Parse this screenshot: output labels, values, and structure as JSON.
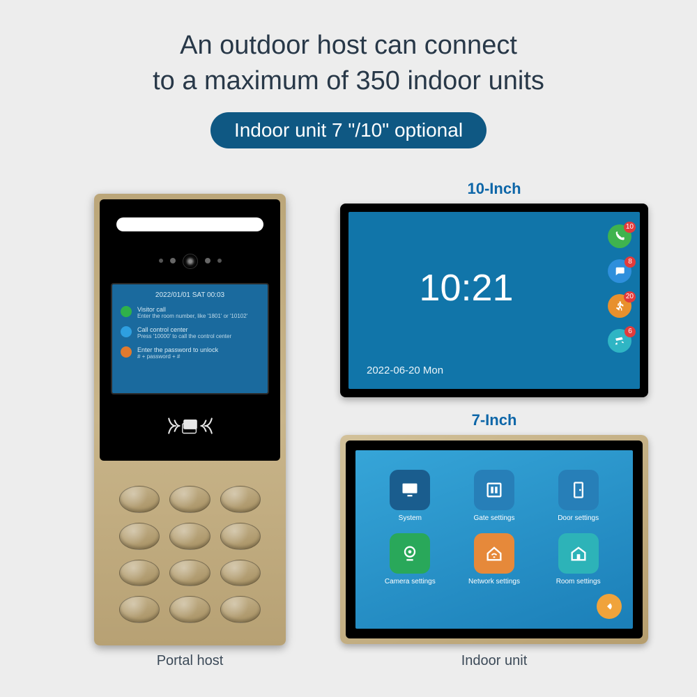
{
  "headline_l1": "An outdoor host can connect",
  "headline_l2": "to a maximum of 350 indoor units",
  "pill": "Indoor unit 7 \"/10\" optional",
  "portal_caption": "Portal host",
  "indoor_caption": "Indoor unit",
  "label_10": "10-Inch",
  "label_7": "7-Inch",
  "portal_lcd": {
    "date": "2022/01/01 SAT 00:03",
    "rows": [
      {
        "title": "Visitor call",
        "sub": "Enter the room number, like '1801' or '10102'"
      },
      {
        "title": "Call control center",
        "sub": "Press '10000' to call the control center"
      },
      {
        "title": "Enter the password to unlock",
        "sub": "# + password + #"
      }
    ]
  },
  "unit10": {
    "time": "10:21",
    "date": "2022-06-20  Mon",
    "badges": [
      "10",
      "8",
      "20",
      "6"
    ]
  },
  "unit7": {
    "apps": [
      "System",
      "Gate settings",
      "Door settings",
      "Camera settings",
      "Network settings",
      "Room settings"
    ]
  }
}
